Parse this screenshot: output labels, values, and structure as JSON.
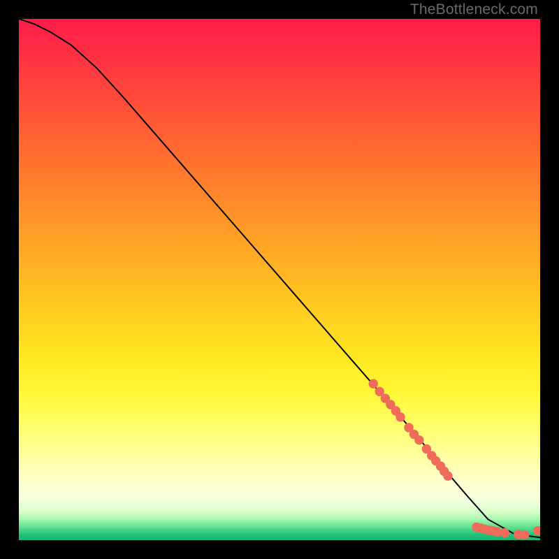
{
  "watermark": "TheBottleneck.com",
  "chart_data": {
    "type": "line",
    "title": "",
    "xlabel": "",
    "ylabel": "",
    "xlim": [
      0,
      100
    ],
    "ylim": [
      0,
      100
    ],
    "grid": false,
    "legend": false,
    "series": [
      {
        "name": "curve",
        "color": "#000000",
        "x": [
          0,
          3,
          6,
          10,
          15,
          20,
          30,
          40,
          50,
          60,
          70,
          78,
          83,
          86,
          90,
          95,
          100
        ],
        "y": [
          100,
          99,
          97.5,
          95,
          90.5,
          85,
          73.5,
          62,
          50.5,
          39,
          27.5,
          18,
          12,
          8.5,
          4,
          1.2,
          0.5
        ]
      }
    ],
    "markers": [
      {
        "name": "highlight-dots",
        "color": "#ef6b5a",
        "radius_plot_units": 0.9,
        "points": [
          {
            "x": 68.0,
            "y": 30.0
          },
          {
            "x": 69.2,
            "y": 28.5
          },
          {
            "x": 70.3,
            "y": 27.2
          },
          {
            "x": 71.3,
            "y": 26.0
          },
          {
            "x": 72.3,
            "y": 24.8
          },
          {
            "x": 73.2,
            "y": 23.6
          },
          {
            "x": 74.8,
            "y": 21.6
          },
          {
            "x": 75.8,
            "y": 20.3
          },
          {
            "x": 76.8,
            "y": 19.2
          },
          {
            "x": 78.2,
            "y": 17.5
          },
          {
            "x": 79.2,
            "y": 16.2
          },
          {
            "x": 80.0,
            "y": 15.2
          },
          {
            "x": 80.9,
            "y": 14.2
          },
          {
            "x": 81.6,
            "y": 13.2
          },
          {
            "x": 82.3,
            "y": 12.3
          },
          {
            "x": 87.8,
            "y": 2.5
          },
          {
            "x": 88.6,
            "y": 2.3
          },
          {
            "x": 89.4,
            "y": 2.1
          },
          {
            "x": 90.2,
            "y": 1.9
          },
          {
            "x": 91.0,
            "y": 1.8
          },
          {
            "x": 91.8,
            "y": 1.6
          },
          {
            "x": 93.2,
            "y": 1.4
          },
          {
            "x": 95.8,
            "y": 1.1
          },
          {
            "x": 97.0,
            "y": 1.0
          },
          {
            "x": 99.6,
            "y": 1.8
          }
        ]
      }
    ],
    "background": {
      "type": "vertical-gradient",
      "stops": [
        {
          "pos": 0.0,
          "color": "#ff1b49"
        },
        {
          "pos": 0.25,
          "color": "#ff6a30"
        },
        {
          "pos": 0.55,
          "color": "#ffca20"
        },
        {
          "pos": 0.8,
          "color": "#ffff7a"
        },
        {
          "pos": 0.93,
          "color": "#e8ffd0"
        },
        {
          "pos": 1.0,
          "color": "#18b874"
        }
      ]
    }
  }
}
